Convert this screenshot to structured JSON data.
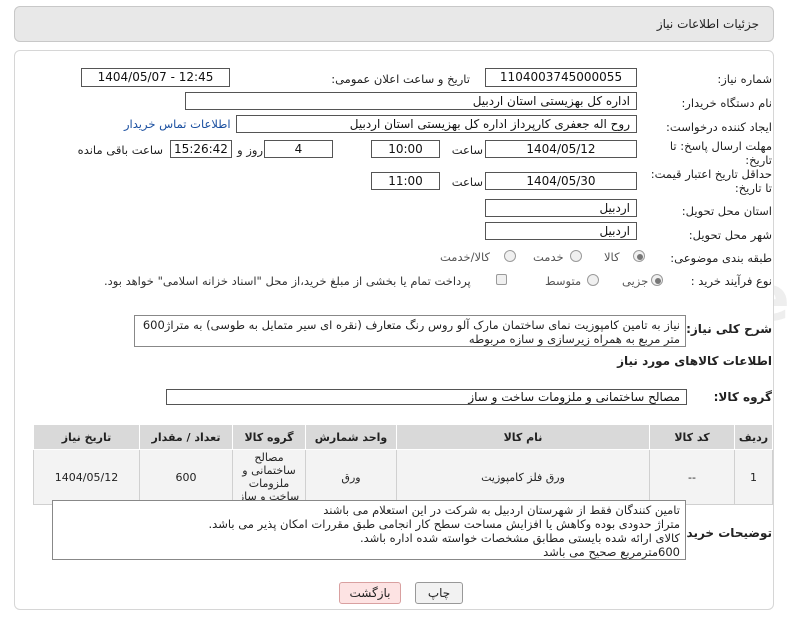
{
  "header": {
    "title": "جزئیات اطلاعات نیاز"
  },
  "fields": {
    "need_number_label": "شماره نیاز:",
    "need_number": "1104003745000055",
    "announce_label": "تاریخ و ساعت اعلان عمومی:",
    "announce_value": "1404/05/07 - 12:45",
    "buyer_org_label": "نام دستگاه خریدار:",
    "buyer_org": "اداره کل بهزیستی استان اردبیل",
    "requester_label": "ایجاد کننده درخواست:",
    "requester": "روح اله جعفری کارپرداز اداره کل بهزیستی استان اردبیل",
    "contact_link": "اطلاعات تماس خریدار",
    "reply_deadline_label_1": "مهلت ارسال پاسخ: تا",
    "reply_deadline_label_2": "تاریخ:",
    "reply_date": "1404/05/12",
    "time_label": "ساعت",
    "reply_time": "10:00",
    "days_value": "4",
    "days_label": "روز و",
    "remaining_time": "15:26:42",
    "remaining_label": "ساعت باقی مانده",
    "price_validity_label_1": "حداقل تاریخ اعتبار قیمت:",
    "price_validity_label_2": "تا تاریخ:",
    "validity_date": "1404/05/30",
    "validity_time": "11:00",
    "delivery_province_label": "استان محل تحویل:",
    "delivery_province": "اردبیل",
    "delivery_city_label": "شهر محل تحویل:",
    "delivery_city": "اردبیل",
    "category_label": "طبقه بندی موضوعی:",
    "category_options": [
      "کالا",
      "خدمت",
      "کالا/خدمت"
    ],
    "process_label": "نوع فرآیند خرید :",
    "process_options": [
      "جزیی",
      "متوسط"
    ],
    "payment_note": "پرداخت تمام یا بخشی از مبلغ خرید،از محل \"اسناد خزانه اسلامی\" خواهد بود."
  },
  "description": {
    "label": "شرح کلی نیاز:",
    "text": "نیاز به تامین کامپوزیت نمای ساختمان مارک آلو روس رنگ متعارف (نقره ای سیر متمایل به طوسی) به متراژ600 متر مربع به همراه زیرسازی و سازه مربوطه"
  },
  "goods": {
    "section_title": "اطلاعات کالاهای مورد نیاز",
    "group_label": "گروه کالا:",
    "group_value": "مصالح ساختمانی و ملزومات ساخت و ساز",
    "columns": [
      "ردیف",
      "کد کالا",
      "نام کالا",
      "واحد شمارش",
      "گروه کالا",
      "تعداد / مقدار",
      "تاریخ نیاز"
    ],
    "rows": [
      [
        "1",
        "--",
        "ورق فلز کامپوزیت",
        "ورق",
        "مصالح ساختمانی و ملزومات ساخت و ساز",
        "600",
        "1404/05/12"
      ]
    ]
  },
  "buyer_notes": {
    "label": "توضیحات خریدار:",
    "lines": [
      "تامین کنندگان فقط از شهرستان اردبیل به شرکت در این استعلام می باشند",
      "متراژ حدودی بوده وکاهش یا افزایش مساحت سطح کار انجامی طبق مقررات امکان پذیر می باشد.",
      "کالای ارائه شده بایستی مطابق مشخصات خواسته شده اداره باشد.",
      "600مترمربع صحیح می باشد"
    ]
  },
  "buttons": {
    "print": "چاپ",
    "back": "بازگشت"
  },
  "colors": {
    "header_bg": "#e8e8e8",
    "link": "#1a4fa0",
    "table_header": "#d9d9d9",
    "back_button": "#fde3e3"
  }
}
